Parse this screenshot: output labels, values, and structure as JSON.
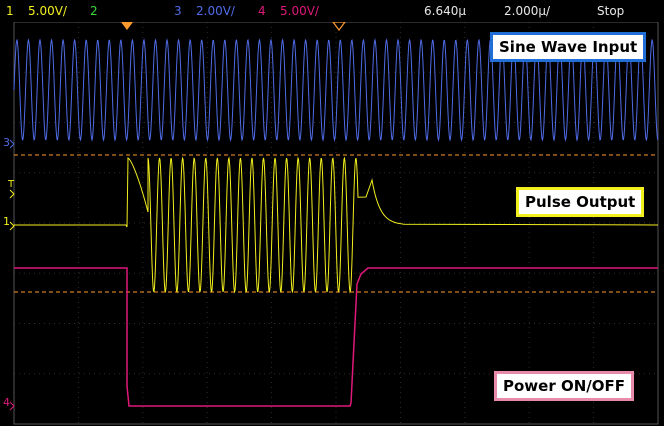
{
  "status": {
    "ch1": {
      "num": "1",
      "scale": "5.00V/"
    },
    "ch2": {
      "num": "2"
    },
    "ch3": {
      "num": "3",
      "scale": "2.00V/"
    },
    "ch4": {
      "num": "4",
      "scale": "5.00V/"
    },
    "time_offset": "6.640µ",
    "timebase": "2.000µ/",
    "run_state": "Stop"
  },
  "colors": {
    "ch1": "#f3ef1e",
    "ch2": "#3ddc3d",
    "ch3": "#4f6be6",
    "ch4": "#e0187a",
    "marker": "#ff9a2e",
    "grid": "#3a3a3a"
  },
  "markers": {
    "ch3_ground": "3",
    "ch1_ground": "1",
    "ch4_ground": "4",
    "trigger": "T"
  },
  "labels": {
    "sine": "Sine Wave Input",
    "pulse": "Pulse Output",
    "power": "Power ON/OFF"
  },
  "label_colors": {
    "sine": "#1f6fd6",
    "pulse": "#f3ef1e",
    "power": "#e88aa8"
  }
}
